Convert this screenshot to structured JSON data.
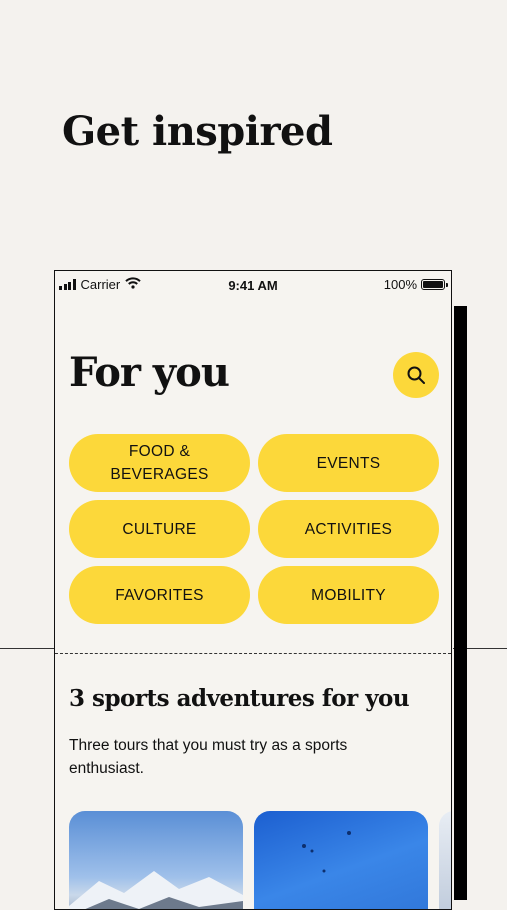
{
  "headline": "Get inspired",
  "status_bar": {
    "carrier": "Carrier",
    "time": "9:41 AM",
    "battery": "100%"
  },
  "header": {
    "title": "For you"
  },
  "categories": [
    {
      "label": "FOOD & BEVERAGES"
    },
    {
      "label": "EVENTS"
    },
    {
      "label": "CULTURE"
    },
    {
      "label": "ACTIVITIES"
    },
    {
      "label": "FAVORITES"
    },
    {
      "label": "MOBILITY"
    }
  ],
  "section": {
    "title": "3 sports adventures for you",
    "description": "Three tours that you must try as a sports enthusiast."
  },
  "icons": {
    "search": "search-icon",
    "wifi": "wifi-icon",
    "signal": "signal-icon",
    "battery": "battery-icon"
  },
  "colors": {
    "accent": "#fcd83a",
    "background": "#f4f2ee",
    "text": "#111111"
  }
}
